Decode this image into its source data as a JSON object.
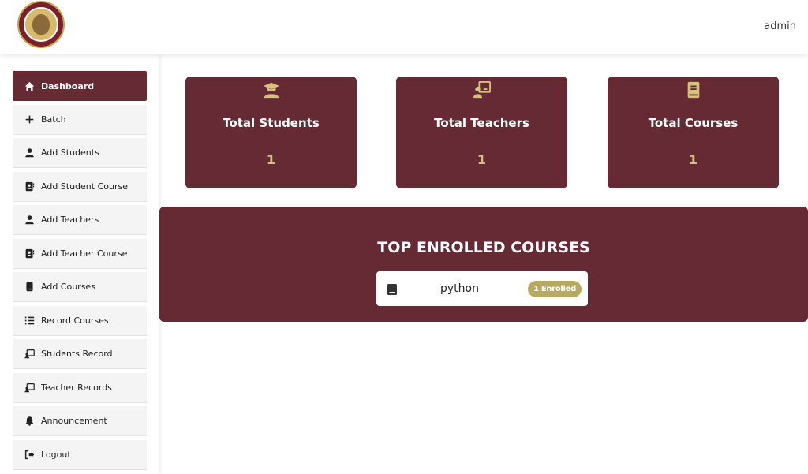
{
  "header": {
    "user": "admin"
  },
  "sidebar": {
    "items": [
      {
        "label": "Dashboard",
        "icon": "home-icon"
      },
      {
        "label": "Batch",
        "icon": "plus-icon"
      },
      {
        "label": "Add Students",
        "icon": "user-icon"
      },
      {
        "label": "Add Student Course",
        "icon": "contact-book-icon"
      },
      {
        "label": "Add Teachers",
        "icon": "user-icon"
      },
      {
        "label": "Add Teacher Course",
        "icon": "contact-book-icon"
      },
      {
        "label": "Add Courses",
        "icon": "book-icon"
      },
      {
        "label": "Record Courses",
        "icon": "list-icon"
      },
      {
        "label": "Students Record",
        "icon": "chalkboard-user-icon"
      },
      {
        "label": "Teacher Records",
        "icon": "chalkboard-user-icon"
      },
      {
        "label": "Announcement",
        "icon": "bell-icon"
      },
      {
        "label": "Logout",
        "icon": "logout-icon"
      }
    ]
  },
  "cards": [
    {
      "title": "Total Students",
      "value": "1",
      "icon": "graduate-icon"
    },
    {
      "title": "Total Teachers",
      "value": "1",
      "icon": "chalkboard-teacher-icon"
    },
    {
      "title": "Total Courses",
      "value": "1",
      "icon": "book-icon"
    }
  ],
  "top_courses": {
    "title": "TOP ENROLLED COURSES",
    "items": [
      {
        "name": "python",
        "badge": "1 Enrolled"
      }
    ]
  },
  "colors": {
    "primary": "#652a34",
    "accent": "#d4c37a",
    "badge": "#b8a962"
  }
}
